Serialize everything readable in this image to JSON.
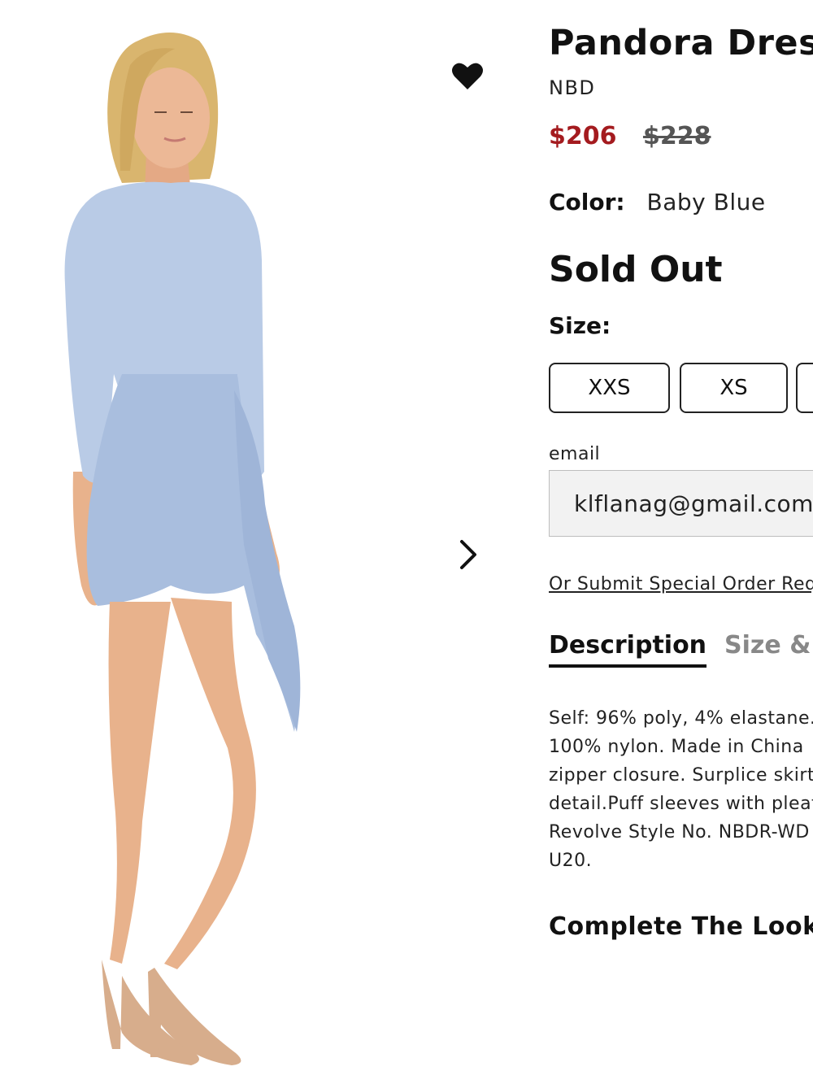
{
  "product": {
    "title": "Pandora Dress",
    "brand": "NBD",
    "sale_price": "$206",
    "original_price": "$228",
    "color_label": "Color:",
    "color_value": "Baby Blue",
    "availability": "Sold Out",
    "size_label": "Size:",
    "sizes": [
      "XXS",
      "XS",
      ""
    ]
  },
  "email": {
    "label": "email",
    "value": "klflanag@gmail.com"
  },
  "special_order_link": "Or Submit Special Order Request",
  "tabs": [
    {
      "label": "Description",
      "active": true
    },
    {
      "label": "Size & Fit",
      "active": false
    }
  ],
  "description_lines": [
    "Self: 96% poly, 4% elastane.",
    "100% nylon. Made in China",
    "zipper closure. Surplice skirt",
    "detail.Puff sleeves with pleat",
    "Revolve Style No. NBDR-WD",
    "U20."
  ],
  "complete_the_look": "Complete The Look",
  "icons": {
    "wishlist": "heart-icon",
    "next": "chevron-right-icon"
  },
  "colors": {
    "sale_price": "#a41b1f",
    "dress": "#b9cbe6",
    "skin": "#e8b28c",
    "hair": "#d9b56e"
  }
}
